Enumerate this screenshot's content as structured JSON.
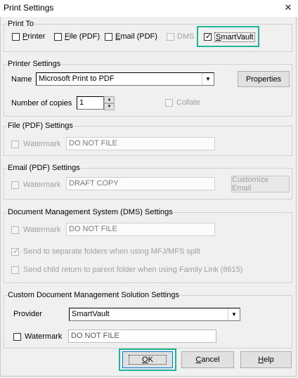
{
  "window": {
    "title": "Print Settings",
    "close_symbol": "✕"
  },
  "print_to": {
    "legend": "Print To",
    "options": [
      {
        "label": "Printer",
        "checked": false,
        "enabled": true
      },
      {
        "label": "File (PDF)",
        "checked": false,
        "enabled": true
      },
      {
        "label": "Email (PDF)",
        "checked": false,
        "enabled": true
      },
      {
        "label": "DMS",
        "checked": false,
        "enabled": false
      },
      {
        "label": "SmartVault",
        "checked": true,
        "enabled": true
      }
    ]
  },
  "printer_settings": {
    "legend": "Printer Settings",
    "name_label": "Name",
    "printer_value": "Microsoft Print to PDF",
    "properties_label": "Properties",
    "copies_label": "Number of copies",
    "copies_value": "1",
    "collate_label": "Collate"
  },
  "file_pdf": {
    "legend": "File (PDF) Settings",
    "watermark_label": "Watermark",
    "watermark_value": "DO NOT FILE"
  },
  "email_pdf": {
    "legend": "Email (PDF) Settings",
    "watermark_label": "Watermark",
    "watermark_value": "DRAFT COPY",
    "customize_label": "Customize Email"
  },
  "dms": {
    "legend": "Document Management System (DMS) Settings",
    "watermark_label": "Watermark",
    "watermark_value": "DO NOT FILE",
    "separate_folders_label": "Send to separate folders when using MFJ/MFS split",
    "separate_folders_checked": true,
    "child_return_label": "Send child return to parent folder when using Family Link (8615)",
    "child_return_checked": false
  },
  "custom_dms": {
    "legend": "Custom Document Management Solution Settings",
    "provider_label": "Provider",
    "provider_value": "SmartVault",
    "watermark_label": "Watermark",
    "watermark_value": "DO NOT FILE"
  },
  "footer": {
    "ok_label": "OK",
    "cancel_label": "Cancel",
    "help_label": "Help"
  },
  "colors": {
    "highlight": "#1fb59a",
    "background": "#f0f0f0"
  }
}
